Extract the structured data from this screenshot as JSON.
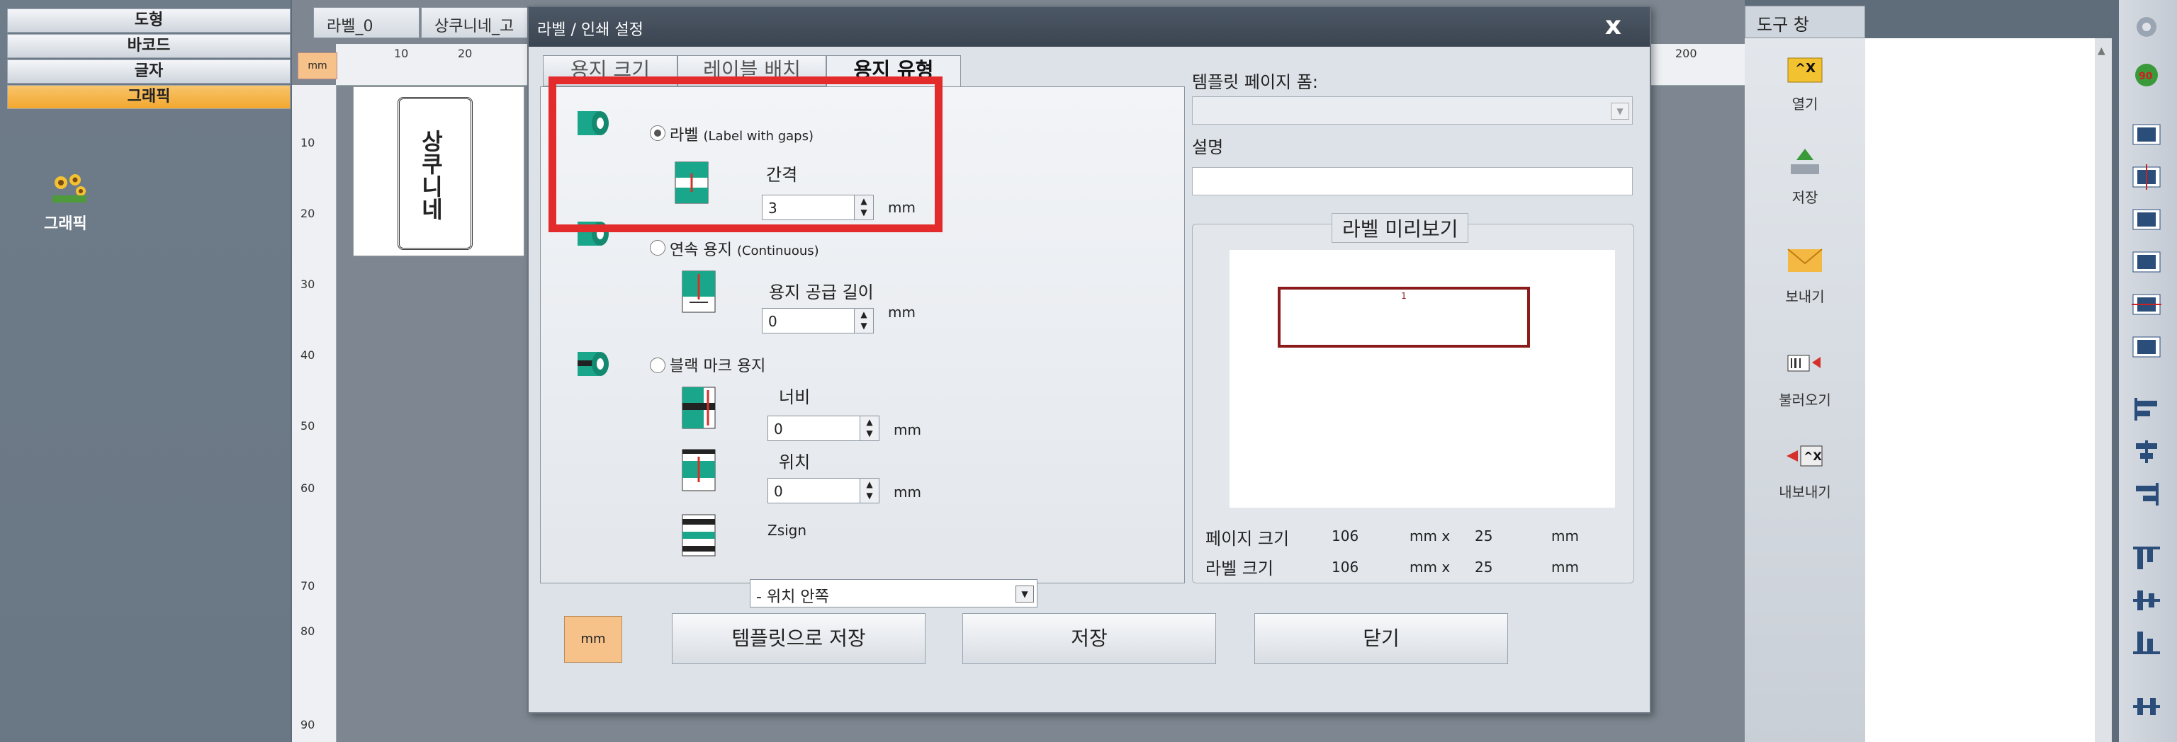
{
  "left_panel": {
    "categories": [
      {
        "label": "도형"
      },
      {
        "label": "바코드"
      },
      {
        "label": "글자"
      },
      {
        "label": "그래픽"
      }
    ],
    "graphic_item_label": "그래픽"
  },
  "canvas": {
    "tabs": [
      "라벨_0",
      "상쿠니네_고"
    ],
    "unit_badge": "mm",
    "h_ticks": [
      "10",
      "20",
      "200"
    ],
    "v_ticks": [
      "10",
      "20",
      "30",
      "40",
      "50",
      "60",
      "70",
      "80",
      "90"
    ],
    "label_text": "상쿠니네"
  },
  "tool_window": {
    "title": "도구 창",
    "buttons": [
      {
        "label": "열기",
        "icon": "open-template-icon"
      },
      {
        "label": "저장",
        "icon": "save-tray-icon"
      },
      {
        "label": "보내기",
        "icon": "send-envelope-icon"
      },
      {
        "label": "불러오기",
        "icon": "import-barcode-icon"
      },
      {
        "label": "내보내기",
        "icon": "export-icon"
      }
    ]
  },
  "dialog": {
    "title": "라벨 / 인쇄 설정",
    "close_label": "x",
    "tabs": [
      {
        "label": "용지 크기",
        "selected": false
      },
      {
        "label": "레이블 배치",
        "selected": false
      },
      {
        "label": "용지 유형",
        "selected": true
      }
    ],
    "media": {
      "gap": {
        "label": "라벨",
        "label_note": "(Label with gaps)",
        "selected": true,
        "field_label": "간격",
        "value": "3",
        "unit": "mm"
      },
      "continuous": {
        "label": "연속 용지",
        "label_note": "(Continuous)",
        "selected": false,
        "field_label": "용지 공급 길이",
        "value": "0",
        "unit": "mm"
      },
      "blackmark": {
        "label": "블랙 마크 용지",
        "selected": false,
        "width_label": "너비",
        "width_value": "0",
        "width_unit": "mm",
        "pos_label": "위치",
        "pos_value": "0",
        "pos_unit": "mm",
        "zsign_label": "Zsign",
        "zsign_value": "- 위치 안쪽"
      }
    },
    "template_form_label": "템플릿 페이지 폼:",
    "template_form_value": "",
    "description_label": "설명",
    "description_value": "",
    "preview": {
      "title": "라벨 미리보기",
      "label_number": "1",
      "page_size_label": "페이지 크기",
      "page_w": "106",
      "page_h": "25",
      "label_size_label": "라벨 크기",
      "label_w": "106",
      "label_h": "25",
      "unit": "mm",
      "by": "mm  x"
    },
    "buttons": {
      "unit": "mm",
      "save_template": "템플릿으로 저장",
      "save": "저장",
      "close": "닫기"
    }
  },
  "colors": {
    "highlight_box": "#e32b2b",
    "active_category": "#f3a830",
    "preview_label_border": "#8b1a1a",
    "icon_teal": "#1aa68a"
  }
}
